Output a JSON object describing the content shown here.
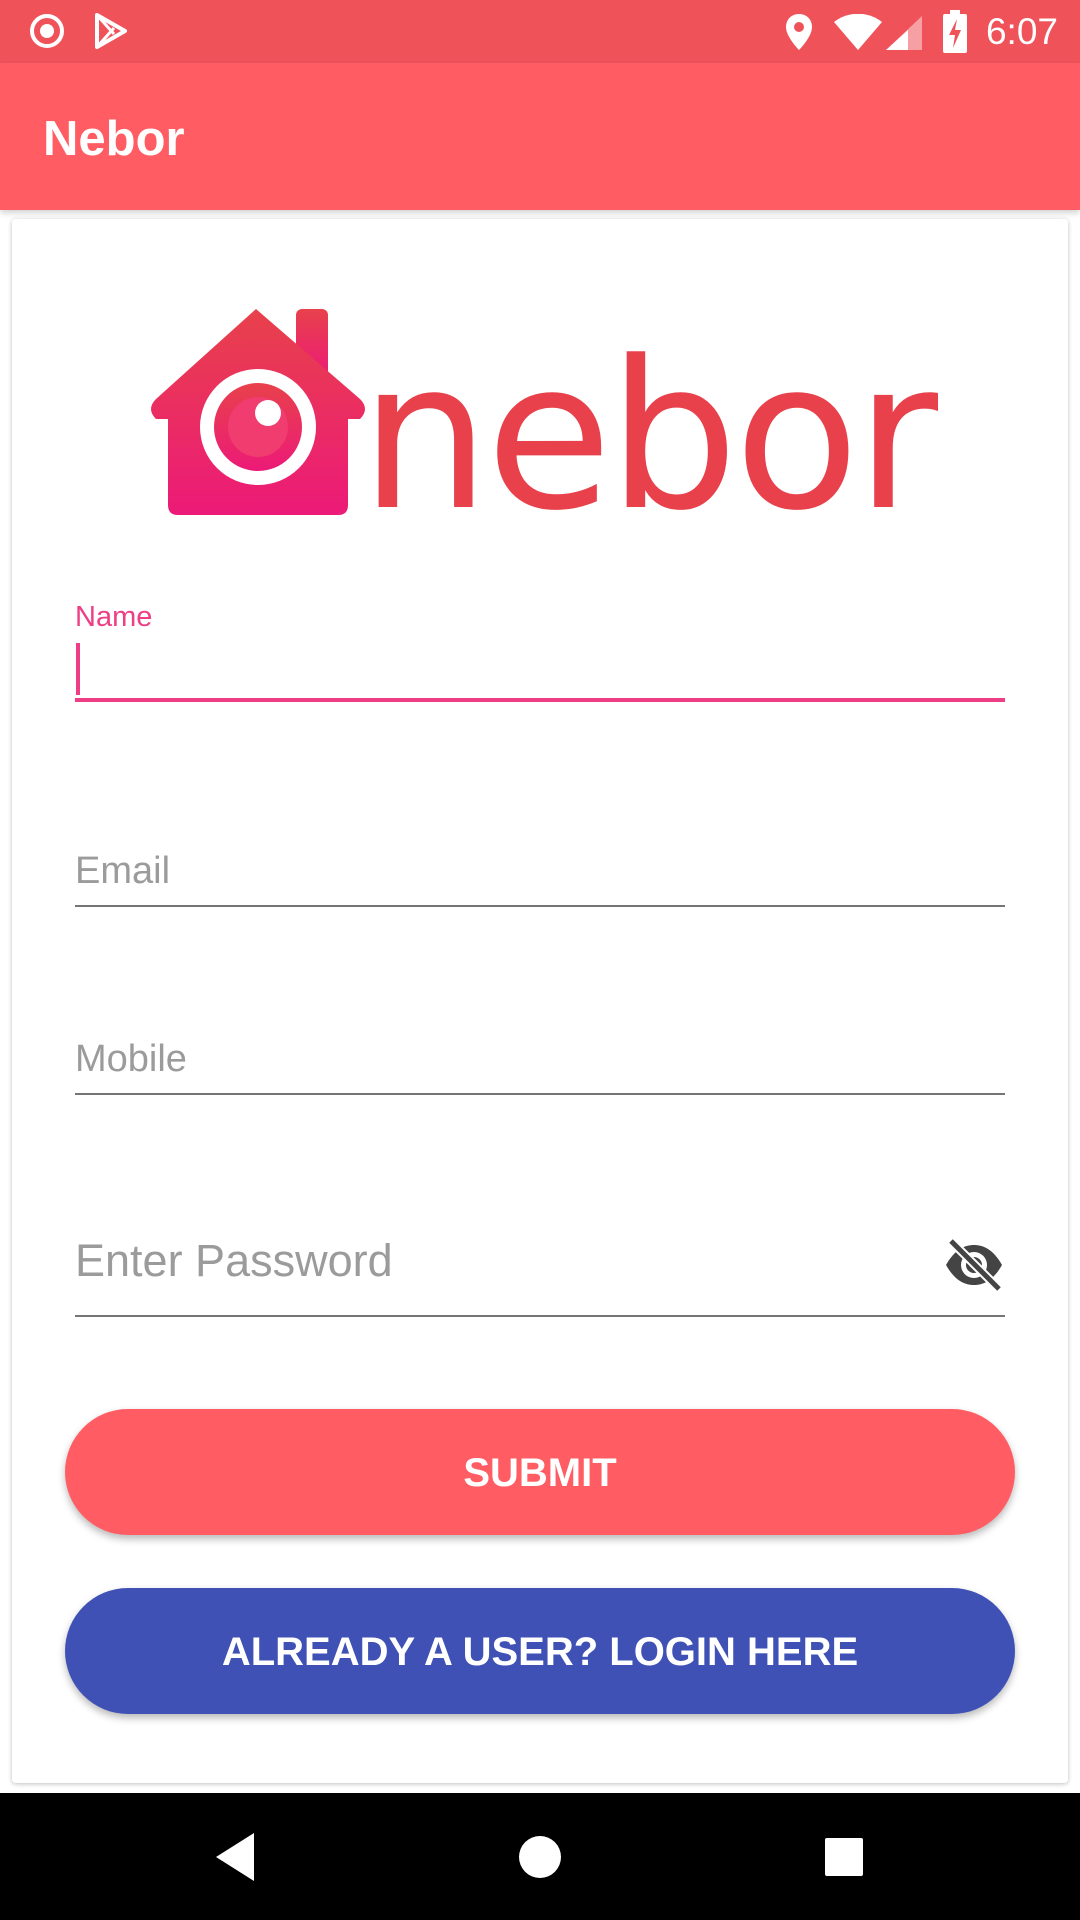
{
  "status_bar": {
    "time": "6:07",
    "left_icons": [
      "record-icon",
      "play-store-icon"
    ],
    "right_icons": [
      "location-icon",
      "wifi-icon",
      "signal-icon",
      "battery-charging-icon"
    ]
  },
  "app_bar": {
    "title": "Nebor"
  },
  "logo": {
    "text": "nebor",
    "icon": "house-eye-icon"
  },
  "form": {
    "name": {
      "label": "Name",
      "value": ""
    },
    "email": {
      "placeholder": "Email",
      "value": ""
    },
    "mobile": {
      "placeholder": "Mobile",
      "value": ""
    },
    "password": {
      "placeholder": "Enter Password",
      "value": "",
      "toggle_icon": "eye-off-icon"
    }
  },
  "buttons": {
    "submit": "SUBMIT",
    "login": "ALREADY A USER? LOGIN HERE"
  },
  "nav_bar": {
    "icons": [
      "back-icon",
      "home-icon",
      "recents-icon"
    ]
  },
  "colors": {
    "status_bar": "#f0525a",
    "app_bar": "#ff5d63",
    "accent": "#ee3e86",
    "submit_button": "#ff5d63",
    "login_button": "#3f51b5"
  }
}
